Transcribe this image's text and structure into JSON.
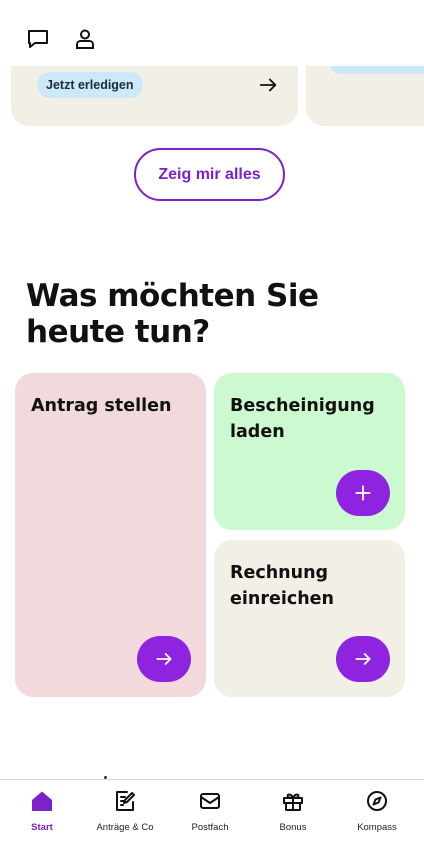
{
  "colors": {
    "accent": "#7b22c9",
    "fab": "#8e24e0",
    "tile_antrag": "#f1d9dc",
    "tile_bescheinigung": "#ccf9cf",
    "tile_rechnung": "#f1efe6",
    "chip": "#cde8f6"
  },
  "header": {
    "icons": [
      "chat-icon",
      "user-icon"
    ]
  },
  "todo": {
    "chip_label": "Jetzt erledigen"
  },
  "show_all_label": "Zeig mir alles",
  "section": {
    "title_line1": "Was möchten Sie",
    "title_line2": "heute tun?"
  },
  "tiles": {
    "antrag": {
      "line1": "Antrag stellen",
      "icon": "arrow-right-icon"
    },
    "bescheinigung": {
      "line1": "Bescheinigung",
      "line2": "laden",
      "icon": "plus-icon"
    },
    "rechnung": {
      "line1": "Rechnung",
      "line2": "einreichen",
      "icon": "arrow-right-icon"
    }
  },
  "nav": {
    "items": [
      {
        "label": "Start",
        "icon": "home-icon",
        "active": true
      },
      {
        "label": "Anträge & Co",
        "icon": "edit-document-icon",
        "active": false
      },
      {
        "label": "Postfach",
        "icon": "mail-icon",
        "active": false
      },
      {
        "label": "Bonus",
        "icon": "gift-icon",
        "active": false
      },
      {
        "label": "Kompass",
        "icon": "compass-icon",
        "active": false
      }
    ]
  }
}
